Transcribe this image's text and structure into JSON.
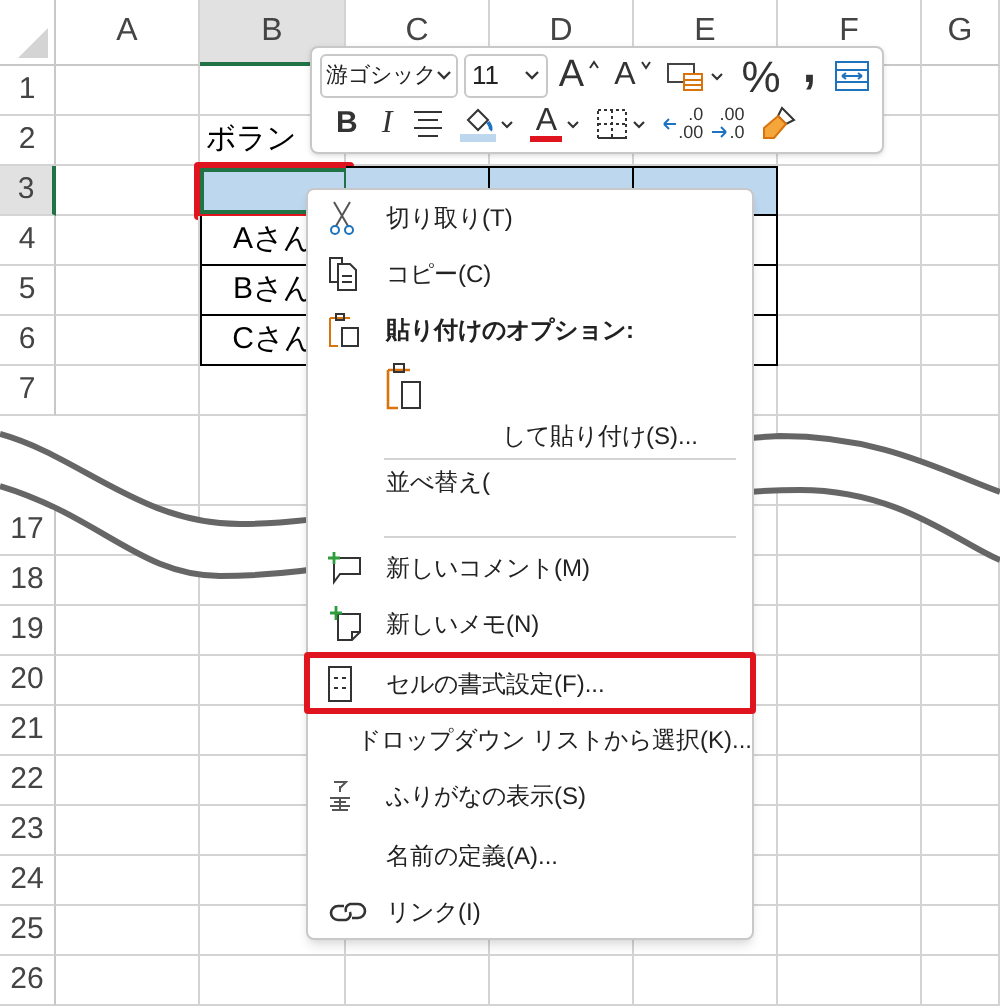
{
  "sheet": {
    "columns": [
      {
        "label": "A",
        "selected": false
      },
      {
        "label": "B",
        "selected": true
      },
      {
        "label": "C",
        "selected": false
      },
      {
        "label": "D",
        "selected": false
      },
      {
        "label": "E",
        "selected": false
      },
      {
        "label": "F",
        "selected": false
      },
      {
        "label": "G",
        "selected": false
      }
    ],
    "rows": [
      {
        "label": "1",
        "selected": false,
        "kind": "plain"
      },
      {
        "label": "2",
        "selected": false,
        "kind": "plain",
        "b": "ボラン"
      },
      {
        "label": "3",
        "selected": true,
        "kind": "table_header"
      },
      {
        "label": "4",
        "selected": false,
        "kind": "table_row",
        "b": "Aさん"
      },
      {
        "label": "5",
        "selected": false,
        "kind": "table_row",
        "b": "Bさん"
      },
      {
        "label": "6",
        "selected": false,
        "kind": "table_row",
        "b": "Cさん"
      },
      {
        "label": "7",
        "selected": false,
        "kind": "plain"
      },
      {
        "kind": "cut"
      },
      {
        "label": "17",
        "selected": false,
        "kind": "plain"
      },
      {
        "label": "18",
        "selected": false,
        "kind": "plain"
      },
      {
        "label": "19",
        "selected": false,
        "kind": "plain"
      },
      {
        "label": "20",
        "selected": false,
        "kind": "plain"
      },
      {
        "label": "21",
        "selected": false,
        "kind": "plain"
      },
      {
        "label": "22",
        "selected": false,
        "kind": "plain"
      },
      {
        "label": "23",
        "selected": false,
        "kind": "plain"
      },
      {
        "label": "24",
        "selected": false,
        "kind": "plain"
      },
      {
        "label": "25",
        "selected": false,
        "kind": "plain"
      },
      {
        "label": "26",
        "selected": false,
        "kind": "plain"
      }
    ],
    "selected_cell_frame": true,
    "wave_break": true
  },
  "mini_toolbar": {
    "font": {
      "value": "游ゴシック"
    },
    "size": {
      "value": "11"
    },
    "row_1": [
      {
        "kind": "grow",
        "label": "A"
      },
      {
        "kind": "shrink",
        "label": "A"
      },
      {
        "kind": "format"
      },
      {
        "kind": "percent",
        "label": "%"
      },
      {
        "kind": "comma",
        "label": ","
      },
      {
        "kind": "wrap"
      }
    ],
    "row_2": [
      {
        "kind": "bold",
        "label": "B"
      },
      {
        "kind": "italic",
        "label": "I"
      },
      {
        "kind": "align"
      },
      {
        "kind": "fill"
      },
      {
        "kind": "font_color",
        "label": "A"
      },
      {
        "kind": "borders"
      },
      {
        "kind": "inc_decimal",
        "label_top": ".0",
        "label_bottom": ".00"
      },
      {
        "kind": "dec_decimal",
        "label_top": ".00",
        "label_bottom": ".0"
      },
      {
        "kind": "painter"
      }
    ]
  },
  "context_menu": {
    "items": [
      {
        "kind": "command",
        "label": "切り取り(T)",
        "highlighted": false
      },
      {
        "kind": "command",
        "label": "コピー(C)",
        "highlighted": false
      },
      {
        "kind": "heading",
        "label": "貼り付けのオプション:"
      },
      {
        "kind": "paste_options"
      },
      {
        "kind": "partial",
        "label": "して貼り付け(S)..."
      },
      {
        "kind": "separator"
      },
      {
        "kind": "command",
        "label": "並べ替え(",
        "highlighted": false
      },
      {
        "kind": "separator"
      },
      {
        "kind": "command",
        "label": "新しいコメント(M)",
        "highlighted": false
      },
      {
        "kind": "command",
        "label": "新しいメモ(N)",
        "highlighted": false
      },
      {
        "kind": "command",
        "label": "セルの書式設定(F)...",
        "highlighted": true
      },
      {
        "kind": "command",
        "label": "ドロップダウン リストから選択(K)...",
        "highlighted": false
      },
      {
        "kind": "command",
        "label": "ふりがなの表示(S)",
        "highlighted": false
      },
      {
        "kind": "command",
        "label": "名前の定義(A)...",
        "highlighted": false
      },
      {
        "kind": "command",
        "label": "リンク(I)",
        "highlighted": false
      }
    ]
  }
}
